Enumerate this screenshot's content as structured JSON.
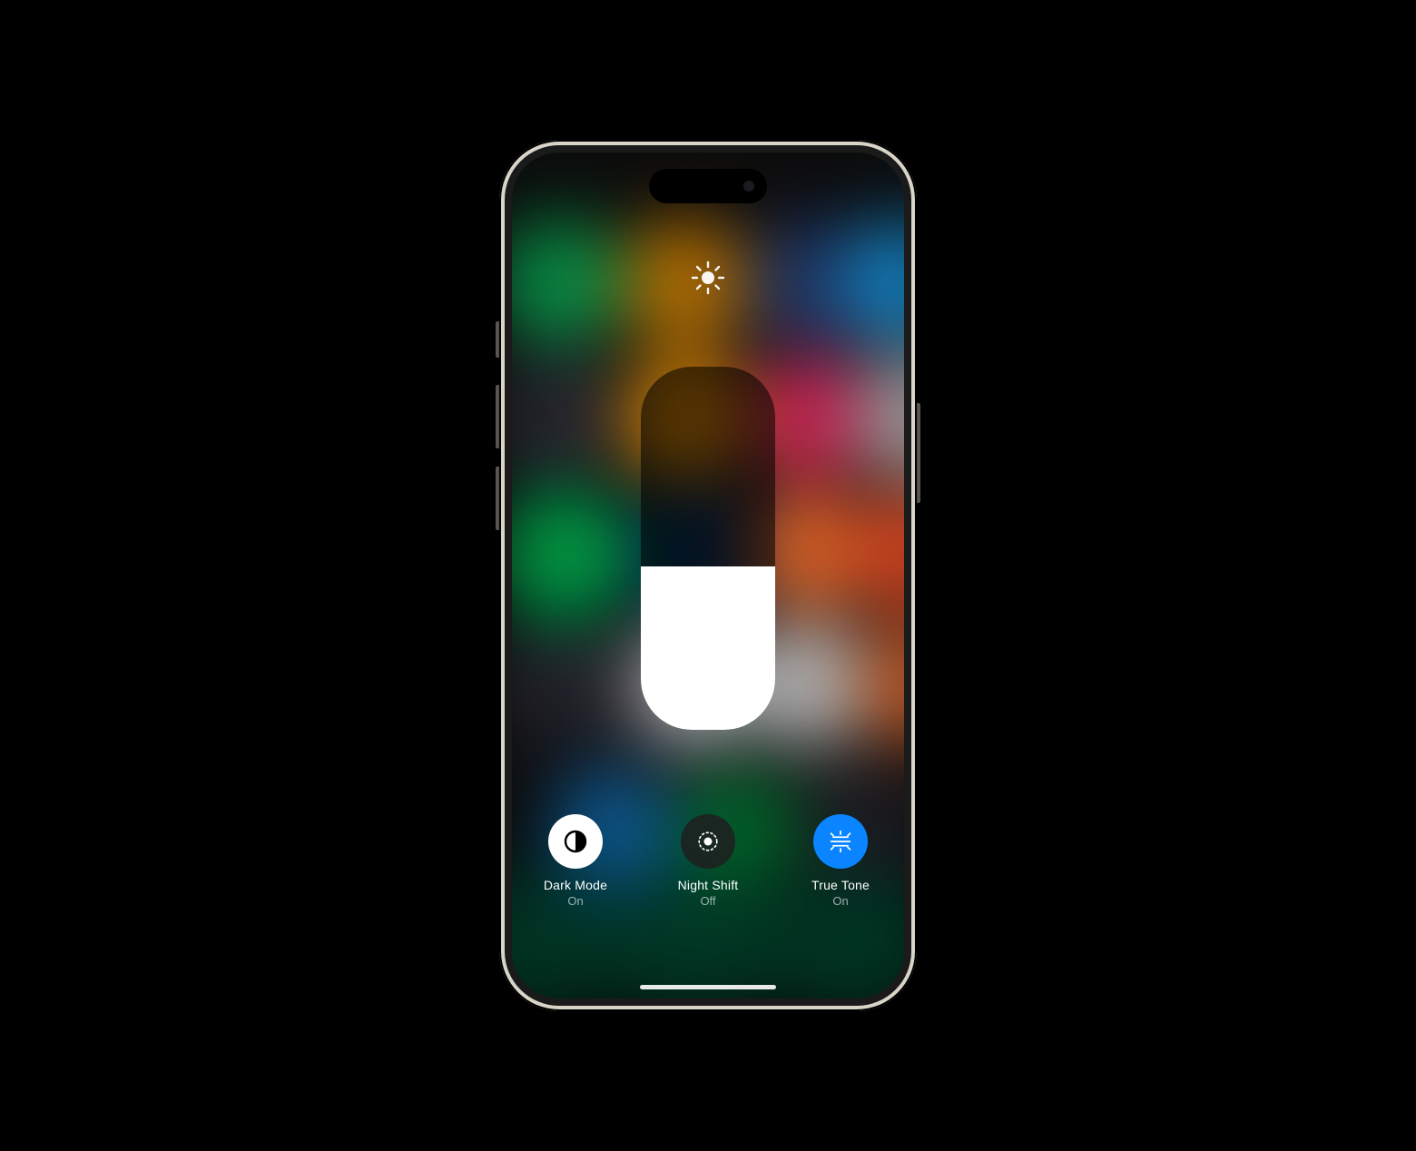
{
  "brightness": {
    "level_percent": 45
  },
  "toggles": [
    {
      "key": "dark_mode",
      "label": "Dark Mode",
      "status": "On",
      "active": true,
      "style": "white",
      "icon": "dark-mode-icon"
    },
    {
      "key": "night_shift",
      "label": "Night Shift",
      "status": "Off",
      "active": false,
      "style": "dark",
      "icon": "night-shift-icon"
    },
    {
      "key": "true_tone",
      "label": "True Tone",
      "status": "On",
      "active": true,
      "style": "blue",
      "icon": "true-tone-icon"
    }
  ]
}
